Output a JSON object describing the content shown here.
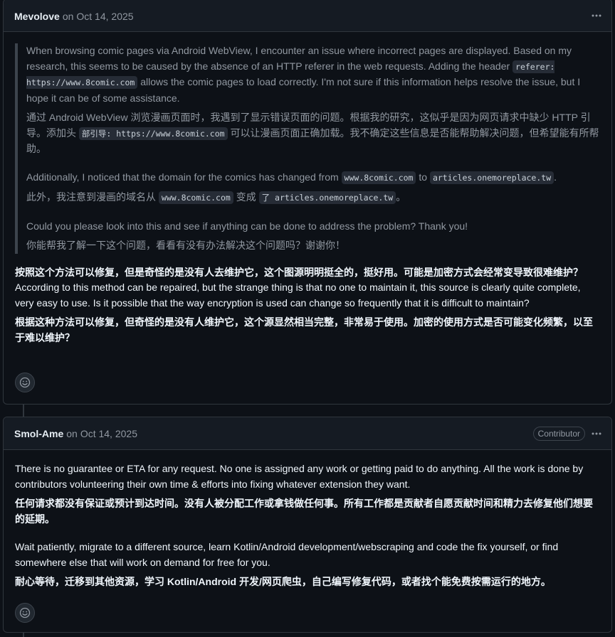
{
  "comments": [
    {
      "author": "Mevolove",
      "date_prefix": "on",
      "date": "Oct 14, 2025",
      "quote": {
        "p1_a": "When browsing comic pages via Android WebView, I encounter an issue where incorrect pages are displayed. Based on my research, this seems to be caused by the absence of an HTTP referer in the web requests. Adding the header ",
        "p1_code1": "referer: https://www.8comic.com",
        "p1_b": " allows the comic pages to load correctly. I'm not sure if this information helps resolve the issue, but I hope it can be of some assistance.",
        "p2_a": "通过 Android WebView 浏览漫画页面时，我遇到了显示错误页面的问题。根据我的研究，这似乎是因为网页请求中缺少 HTTP 引导。添加头 ",
        "p2_code1": "部引导: https://www.8comic.com",
        "p2_b": " 可以让漫画页面正确加载。我不确定这些信息是否能帮助解决问题，但希望能有所帮助。",
        "p3_a": "Additionally, I noticed that the domain for the comics has changed from ",
        "p3_code1": "www.8comic.com",
        "p3_b": " to ",
        "p3_code2": "articles.onemoreplace.tw",
        "p3_c": ".",
        "p4_a": "此外，我注意到漫画的域名从 ",
        "p4_code1": "www.8comic.com",
        "p4_b": " 变成 ",
        "p4_code2": "了 articles.onemoreplace.tw",
        "p4_c": "。",
        "p5": "Could you please look into this and see if anything can be done to address the problem? Thank you!",
        "p6": "你能帮我了解一下这个问题，看看有没有办法解决这个问题吗？谢谢你！"
      },
      "reply_zh": "按照这个方法可以修复，但是奇怪的是没有人去维护它，这个图源明明挺全的，挺好用。可能是加密方式会经常变导致很难维护？",
      "reply_en": "According to this method can be repaired, but the strange thing is that no one to maintain it, this source is clearly quite complete, very easy to use. Is it possible that the way encryption is used can change so frequently that it is difficult to maintain?",
      "reply_zh2": "根据这种方法可以修复，但奇怪的是没有人维护它，这个源显然相当完整，非常易于使用。加密的使用方式是否可能变化频繁，以至于难以维护？"
    },
    {
      "author": "Smol-Ame",
      "date_prefix": "on",
      "date": "Oct 14, 2025",
      "badge": "Contributor",
      "p1": "There is no guarantee or ETA for any request. No one is assigned any work or getting paid to do anything. All the work is done by contributors volunteering their own time & efforts into fixing whatever extension they want.",
      "p2": "任何请求都没有保证或预计到达时间。没有人被分配工作或拿钱做任何事。所有工作都是贡献者自愿贡献时间和精力去修复他们想要的延期。",
      "p3": "Wait patiently, migrate to a different source, learn Kotlin/Android development/webscraping and code the fix yourself, or find somewhere else that will work on demand for free for you.",
      "p4": "耐心等待，迁移到其他资源，学习 Kotlin/Android 开发/网页爬虫，自己编写修复代码，或者找个能免费按需运行的地方。"
    }
  ],
  "icons": {
    "kebab": "kebab-horizontal-icon",
    "emoji": "smiley-icon"
  },
  "colors": {
    "background": "#0d1117",
    "header": "#151b23",
    "border": "#30363d",
    "muted": "#9198a1",
    "text": "#f0f6fc"
  }
}
